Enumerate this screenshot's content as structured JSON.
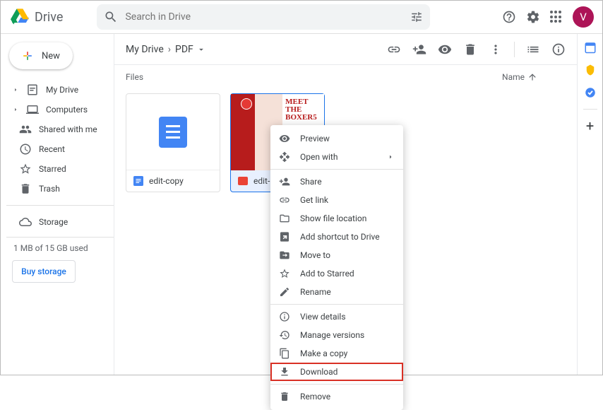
{
  "app": {
    "name": "Drive"
  },
  "search": {
    "placeholder": "Search in Drive"
  },
  "avatar": {
    "initial": "V"
  },
  "newButton": {
    "label": "New"
  },
  "sidebar": {
    "items": [
      {
        "label": "My Drive",
        "icon": "my-drive"
      },
      {
        "label": "Computers",
        "icon": "computers"
      },
      {
        "label": "Shared with me",
        "icon": "shared"
      },
      {
        "label": "Recent",
        "icon": "recent"
      },
      {
        "label": "Starred",
        "icon": "star"
      },
      {
        "label": "Trash",
        "icon": "trash"
      }
    ],
    "storage": {
      "label": "Storage"
    },
    "storage_text": "1 MB of 15 GB used",
    "buy": "Buy storage"
  },
  "breadcrumb": {
    "root": "My Drive",
    "folder": "PDF"
  },
  "list_header": {
    "files": "Files",
    "name": "Name"
  },
  "files": [
    {
      "name": "edit-copy",
      "type": "doc"
    },
    {
      "name": "edit-",
      "type": "pdf",
      "thumb_title_line1": "MEET THE",
      "thumb_title_line2": "BOXER5"
    }
  ],
  "context_menu": {
    "preview": "Preview",
    "open_with": "Open with",
    "share": "Share",
    "get_link": "Get link",
    "show_location": "Show file location",
    "add_shortcut": "Add shortcut to Drive",
    "move_to": "Move to",
    "add_starred": "Add to Starred",
    "rename": "Rename",
    "view_details": "View details",
    "manage_versions": "Manage versions",
    "make_copy": "Make a copy",
    "download": "Download",
    "remove": "Remove"
  }
}
